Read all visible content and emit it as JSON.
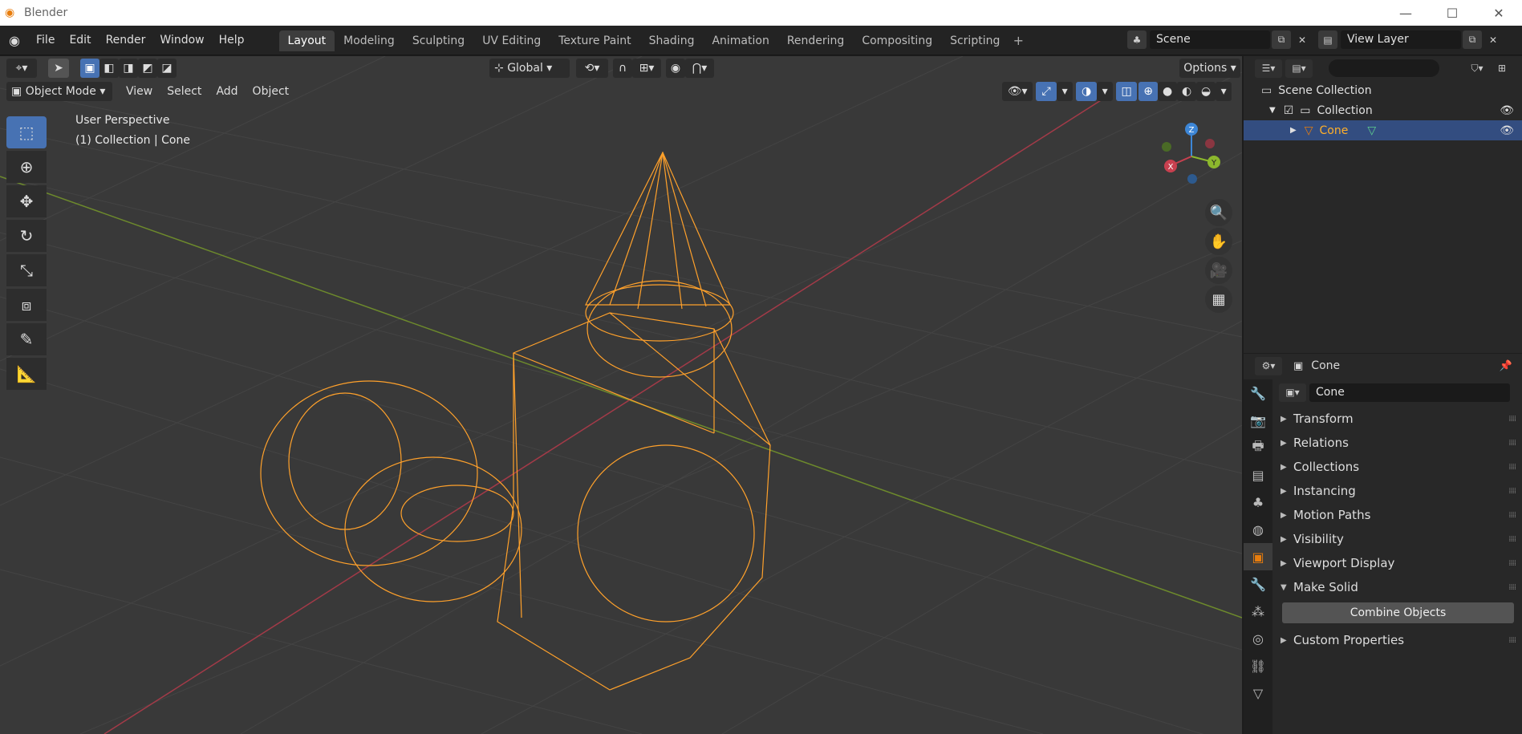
{
  "app": {
    "title": "Blender"
  },
  "menu": [
    "File",
    "Edit",
    "Render",
    "Window",
    "Help"
  ],
  "workspaces": [
    "Layout",
    "Modeling",
    "Sculpting",
    "UV Editing",
    "Texture Paint",
    "Shading",
    "Animation",
    "Rendering",
    "Compositing",
    "Scripting"
  ],
  "active_workspace": "Layout",
  "scene": {
    "name": "Scene",
    "view_layer": "View Layer"
  },
  "viewport": {
    "mode": "Object Mode",
    "menus": [
      "View",
      "Select",
      "Add",
      "Object"
    ],
    "transform_orientation": "Global",
    "options_label": "Options",
    "perspective_text": "User Perspective",
    "collection_text": "(1) Collection | Cone",
    "gizmo": {
      "x": "X",
      "y": "Y",
      "z": "Z"
    }
  },
  "outliner": {
    "search_placeholder": "",
    "scene_collection": "Scene Collection",
    "collection": "Collection",
    "object": "Cone"
  },
  "properties": {
    "context_name": "Cone",
    "object_name": "Cone",
    "panels": [
      "Transform",
      "Relations",
      "Collections",
      "Instancing",
      "Motion Paths",
      "Visibility",
      "Viewport Display",
      "Make Solid"
    ],
    "combine_button": "Combine Objects",
    "custom_properties": "Custom Properties"
  },
  "colors": {
    "selection": "#ffa12b",
    "accent_blue": "#4772b3",
    "x_axis": "#c8404f",
    "y_axis": "#8cb82d",
    "z_axis": "#3d86d6"
  }
}
